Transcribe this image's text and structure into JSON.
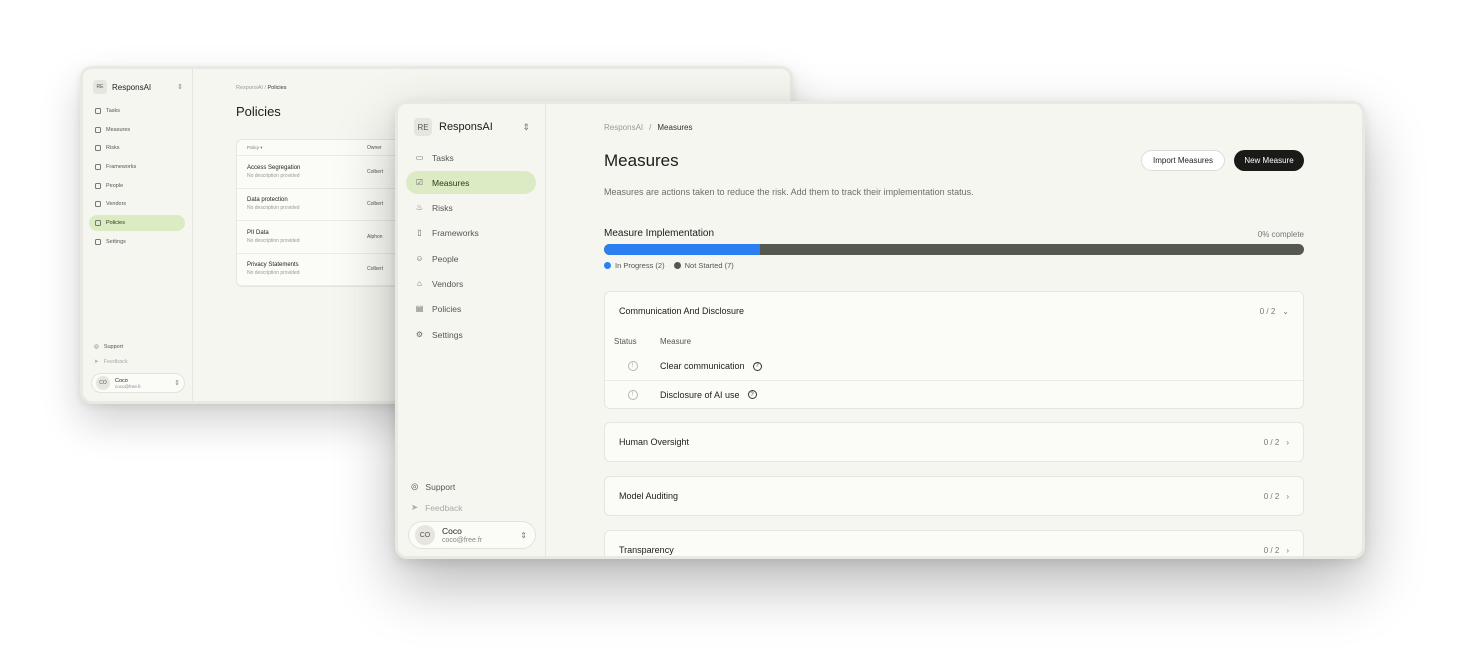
{
  "back_window": {
    "org": {
      "badge": "RE",
      "name": "ResponsAI"
    },
    "nav": [
      {
        "label": "Tasks",
        "icon": "inbox-icon"
      },
      {
        "label": "Measures",
        "icon": "check-square-icon"
      },
      {
        "label": "Risks",
        "icon": "flame-icon"
      },
      {
        "label": "Frameworks",
        "icon": "book-icon"
      },
      {
        "label": "People",
        "icon": "users-icon"
      },
      {
        "label": "Vendors",
        "icon": "store-icon"
      },
      {
        "label": "Policies",
        "icon": "file-icon",
        "active": true
      },
      {
        "label": "Settings",
        "icon": "gear-icon"
      }
    ],
    "support": "Support",
    "feedback": "Feedback",
    "user": {
      "initials": "CO",
      "name": "Coco",
      "email": "coco@free.fr"
    },
    "breadcrumb": {
      "root": "ResponsAI",
      "separator": "/",
      "current": "Policies"
    },
    "title": "Policies",
    "table": {
      "columns": [
        "Policy",
        "Owner"
      ],
      "rows": [
        {
          "title": "Access Segregation",
          "desc": "No description provided",
          "owner": "Colbert"
        },
        {
          "title": "Data protection",
          "desc": "No description provided",
          "owner": "Colbert"
        },
        {
          "title": "PII Data",
          "desc": "No description provided",
          "owner": "Alphon"
        },
        {
          "title": "Privacy Statements",
          "desc": "No description provided",
          "owner": "Colbert"
        }
      ]
    }
  },
  "front_window": {
    "org": {
      "badge": "RE",
      "name": "ResponsAI"
    },
    "nav": [
      {
        "label": "Tasks",
        "icon": "inbox-icon"
      },
      {
        "label": "Measures",
        "icon": "check-square-icon",
        "active": true
      },
      {
        "label": "Risks",
        "icon": "flame-icon"
      },
      {
        "label": "Frameworks",
        "icon": "book-icon"
      },
      {
        "label": "People",
        "icon": "users-icon"
      },
      {
        "label": "Vendors",
        "icon": "store-icon"
      },
      {
        "label": "Policies",
        "icon": "file-icon"
      },
      {
        "label": "Settings",
        "icon": "gear-icon"
      }
    ],
    "support": "Support",
    "feedback": "Feedback",
    "user": {
      "initials": "CO",
      "name": "Coco",
      "email": "coco@free.fr"
    },
    "breadcrumb": {
      "root": "ResponsAI",
      "separator": "/",
      "current": "Measures"
    },
    "title": "Measures",
    "import_button": "Import Measures",
    "new_button": "New Measure",
    "description": "Measures are actions taken to reduce the risk. Add them to track their implementation status.",
    "implementation": {
      "title": "Measure Implementation",
      "percent_label": "0% complete",
      "in_progress_fraction": 0.2222,
      "legend": [
        {
          "label": "In Progress (2)",
          "color": "#2b7ff0"
        },
        {
          "label": "Not Started (7)",
          "color": "#54584f"
        }
      ]
    },
    "groups": [
      {
        "name": "Communication And Disclosure",
        "count": "0 / 2",
        "expanded": true,
        "columns": {
          "status": "Status",
          "measure": "Measure"
        },
        "measures": [
          {
            "name": "Clear communication"
          },
          {
            "name": "Disclosure of AI use"
          }
        ]
      },
      {
        "name": "Human Oversight",
        "count": "0 / 2",
        "expanded": false
      },
      {
        "name": "Model Auditing",
        "count": "0 / 2",
        "expanded": false
      },
      {
        "name": "Transparency",
        "count": "0 / 2",
        "expanded": false
      }
    ]
  },
  "colors": {
    "accent_active": "#dcebc3",
    "progress_blue": "#2b7ff0",
    "progress_gray": "#54584f",
    "primary_button": "#1a1a18"
  }
}
